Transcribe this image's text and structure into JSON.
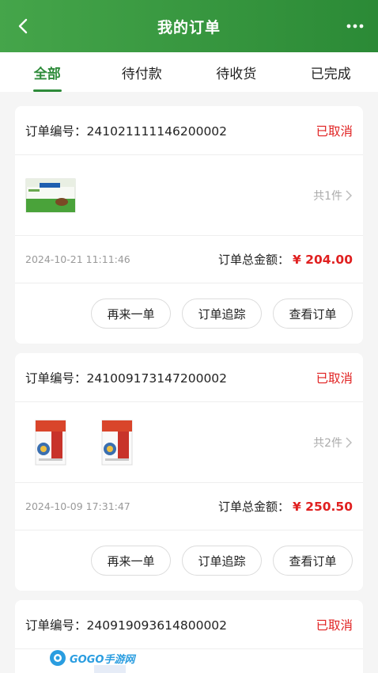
{
  "header": {
    "title": "我的订单",
    "back_icon": "chevron-left-icon",
    "more_icon": "more-dots-icon"
  },
  "tabs": [
    {
      "label": "全部",
      "active": true
    },
    {
      "label": "待付款",
      "active": false
    },
    {
      "label": "待收货",
      "active": false
    },
    {
      "label": "已完成",
      "active": false
    }
  ],
  "orders": [
    {
      "order_no_label": "订单编号：",
      "order_no": "241021111146200002",
      "status": "已取消",
      "goods_count": "共1件",
      "date": "2024-10-21 11:11:46",
      "total_label": "订单总金额：",
      "total": "¥ 204.00",
      "buttons": [
        "再来一单",
        "订单追踪",
        "查看订单"
      ]
    },
    {
      "order_no_label": "订单编号：",
      "order_no": "241009173147200002",
      "status": "已取消",
      "goods_count": "共2件",
      "date": "2024-10-09 17:31:47",
      "total_label": "订单总金额：",
      "total": "¥ 250.50",
      "buttons": [
        "再来一单",
        "订单追踪",
        "查看订单"
      ]
    },
    {
      "order_no_label": "订单编号：",
      "order_no": "240919093614800002",
      "status": "已取消"
    }
  ],
  "watermark": {
    "text": "GOGO手游网"
  },
  "colors": {
    "brand_green": "#2e8b3a",
    "status_red": "#e02020"
  }
}
